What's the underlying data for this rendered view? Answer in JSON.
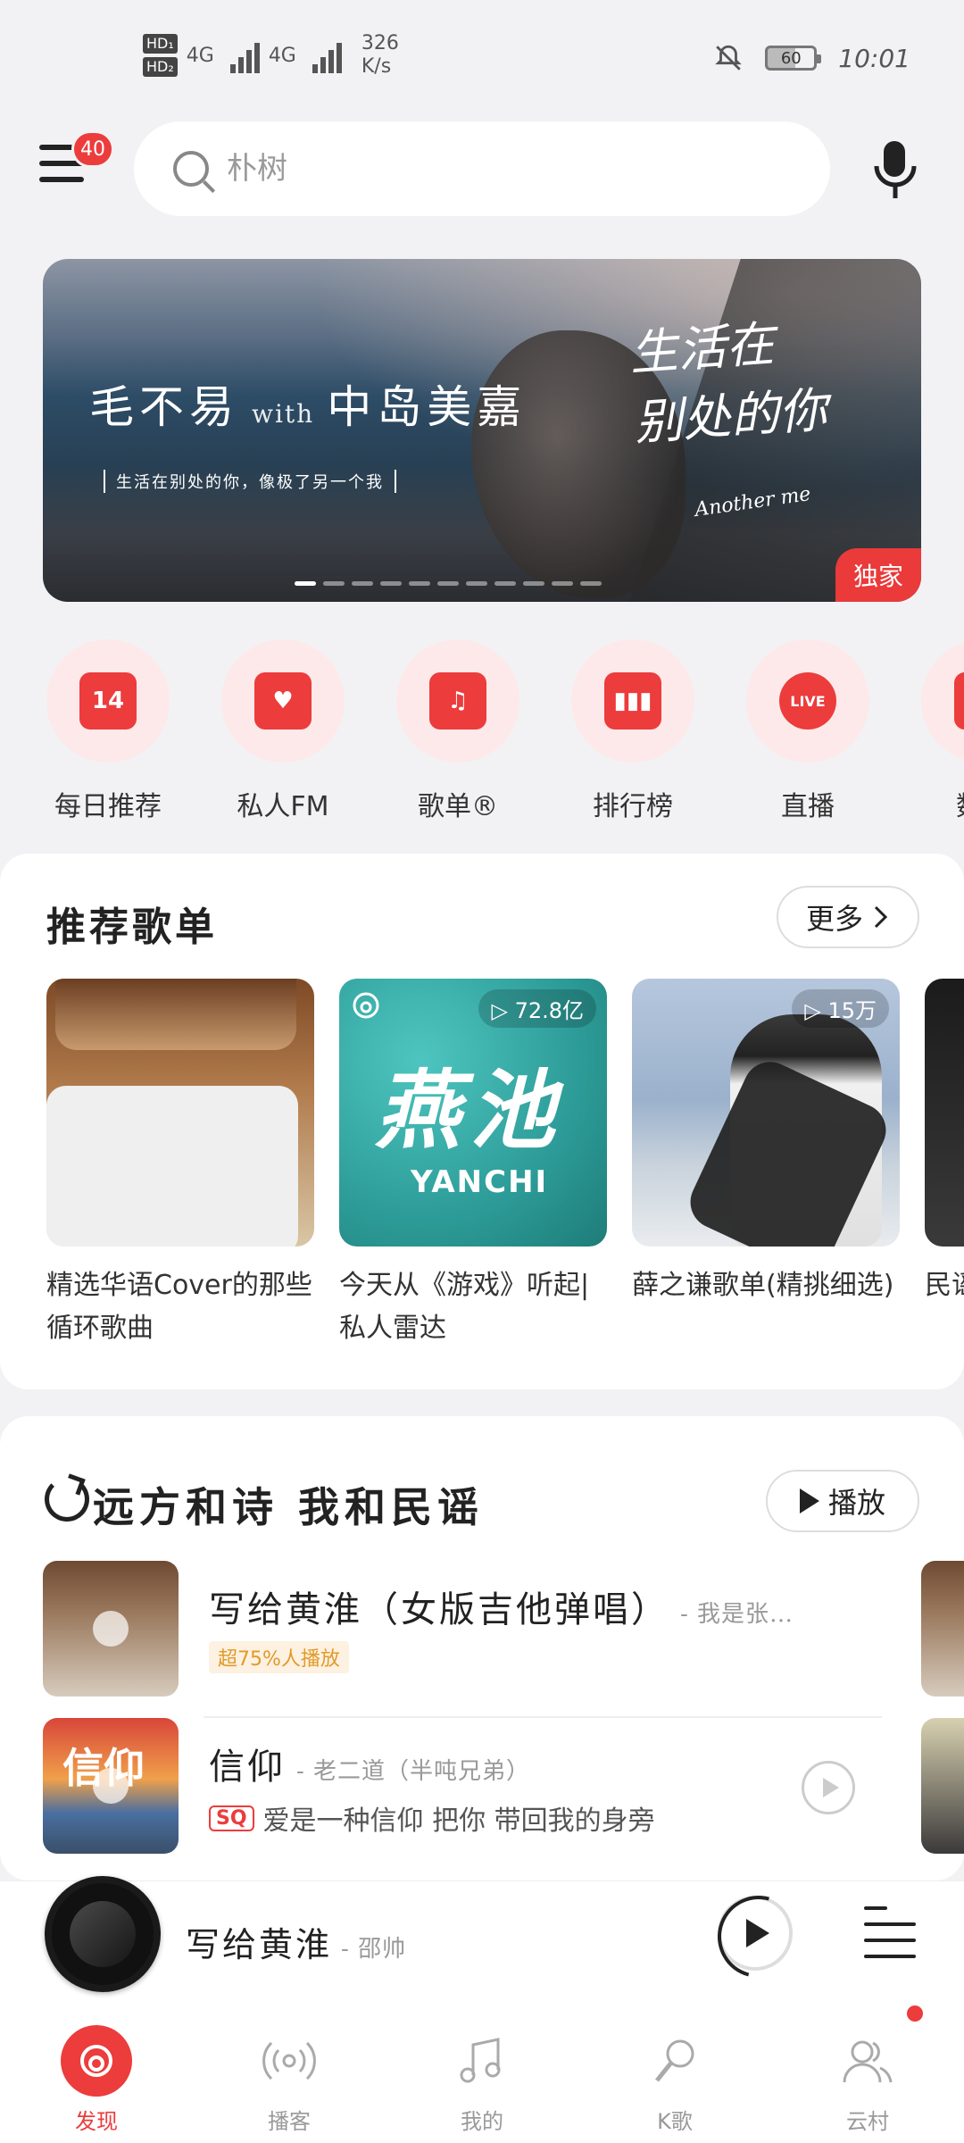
{
  "status": {
    "hd1": "HD₁",
    "hd2": "HD₂",
    "net1": "4G",
    "net2": "4G",
    "speed_value": "326",
    "speed_unit": "K/s",
    "battery": "60",
    "time": "10:01"
  },
  "header": {
    "menu_badge": "40",
    "search_placeholder": "朴树"
  },
  "banner": {
    "title_left": "毛不易",
    "title_with": "with",
    "title_right": "中岛美嘉",
    "subtitle": "生活在别处的你，像极了另一个我",
    "script_line1": "生活在",
    "script_line2": "别处的你",
    "script_small": "Another me",
    "exclusive": "独家",
    "dot_count": 11,
    "active_dot": 0
  },
  "quick_links": [
    {
      "label": "每日推荐",
      "icon": "calendar-icon",
      "glyph": "14"
    },
    {
      "label": "私人FM",
      "icon": "radio-icon",
      "glyph": "♥"
    },
    {
      "label": "歌单®",
      "icon": "playlist-icon",
      "glyph": "♫"
    },
    {
      "label": "排行榜",
      "icon": "chart-bars-icon",
      "glyph": "▮▮▮"
    },
    {
      "label": "直播",
      "icon": "live-icon",
      "glyph": "LIVE"
    },
    {
      "label": "数字",
      "icon": "digital-icon",
      "glyph": "◎"
    }
  ],
  "recommended": {
    "title": "推荐歌单",
    "more_label": "更多",
    "playlists": [
      {
        "title": "精选华语Cover的那些循环歌曲",
        "count": ""
      },
      {
        "title": "今天从《游戏》听起|私人雷达",
        "count": "72.8亿",
        "cover_big": "燕池",
        "cover_sub": "YANCHI"
      },
      {
        "title": "薛之谦歌单(精挑细选)",
        "count": "15万"
      },
      {
        "title": "民谣的人",
        "count": ""
      }
    ]
  },
  "folk": {
    "title": "远方和诗 我和民谣",
    "play_label": "播放",
    "songs": [
      {
        "name": "写给黄淮（女版吉他弹唱）",
        "artist": "- 我是张…",
        "tag": "超75%人播放",
        "tag_type": "hot",
        "extra": ""
      },
      {
        "name": "信仰",
        "artist": "- 老二道（半吨兄弟）",
        "tag": "SQ",
        "tag_type": "sq",
        "extra": "爱是一种信仰 把你 带回我的身旁",
        "art_text": "信仰"
      }
    ]
  },
  "player": {
    "song": "写给黄淮",
    "artist": "- 邵帅"
  },
  "tabs": [
    {
      "label": "发现",
      "icon": "discover-icon",
      "active": true
    },
    {
      "label": "播客",
      "icon": "podcast-icon",
      "active": false
    },
    {
      "label": "我的",
      "icon": "music-note-icon",
      "active": false
    },
    {
      "label": "K歌",
      "icon": "karaoke-mic-icon",
      "active": false
    },
    {
      "label": "云村",
      "icon": "community-icon",
      "active": false
    }
  ],
  "colors": {
    "accent": "#ec3c3c",
    "background": "#f2f2f4"
  }
}
